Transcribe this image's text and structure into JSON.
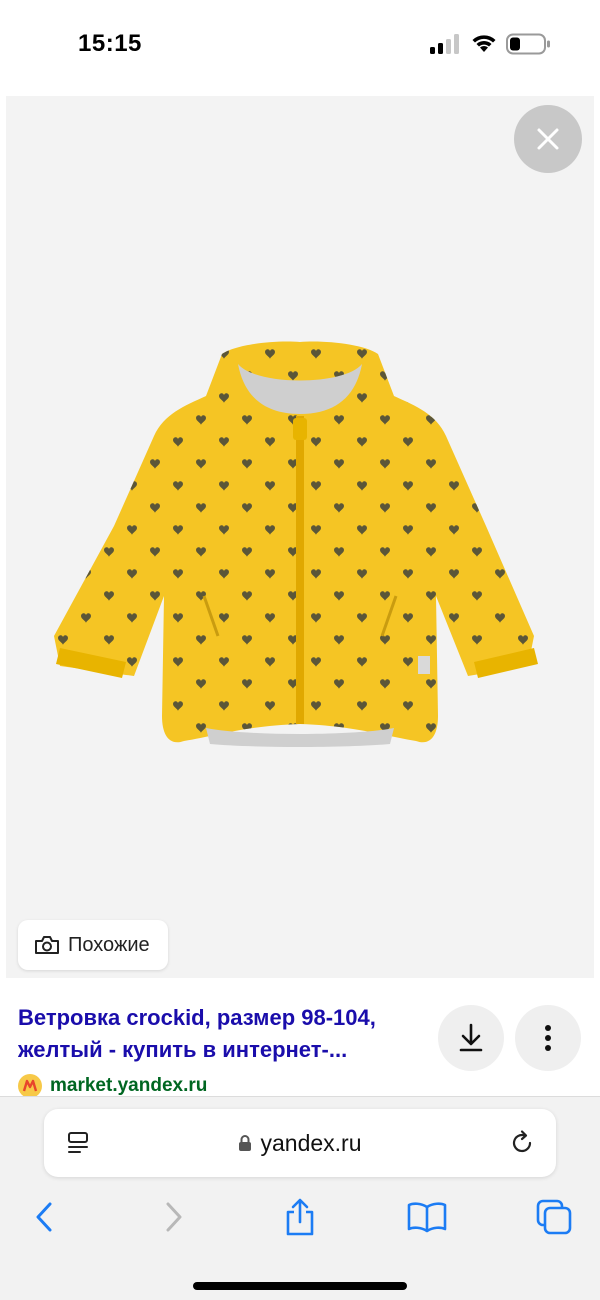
{
  "status_bar": {
    "time": "15:15"
  },
  "viewer": {
    "similar_label": "Похожие"
  },
  "result": {
    "title": "Ветровка crockid, размер 98-104, желтый - купить в интернет-...",
    "source_domain": "market.yandex.ru"
  },
  "browser": {
    "url": "yandex.ru"
  },
  "colors": {
    "jacket": "#f5c524",
    "title_link": "#1a0dab",
    "source_green": "#006621",
    "ios_blue": "#1c7cf4"
  },
  "icons": {
    "close": "close-icon",
    "similar": "camera-search-icon",
    "download": "download-icon",
    "more": "more-vertical-icon",
    "tabs_overview": "list-icon",
    "lock": "lock-icon",
    "reload": "reload-icon",
    "back": "chevron-left-icon",
    "forward": "chevron-right-icon",
    "share": "share-icon",
    "bookmarks": "book-icon",
    "tabs": "tabs-icon"
  }
}
